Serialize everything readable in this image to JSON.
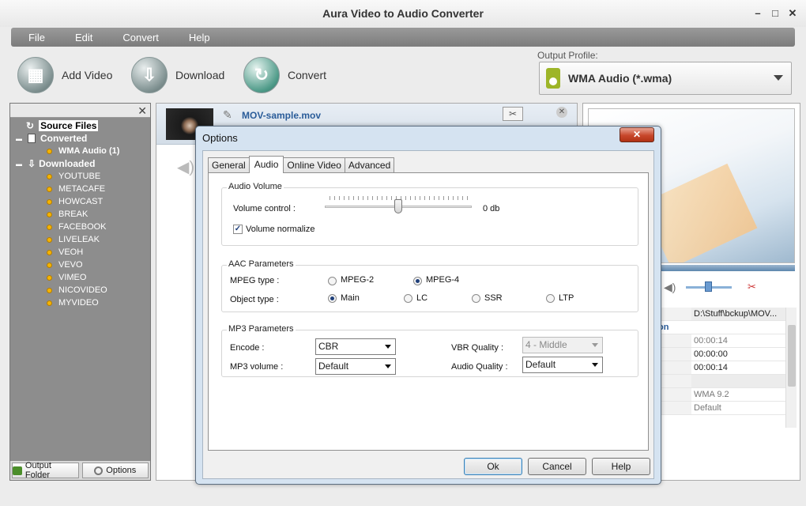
{
  "window": {
    "title": "Aura Video to Audio Converter"
  },
  "menu": [
    "File",
    "Edit",
    "Convert",
    "Help"
  ],
  "toolbar": {
    "add_video": "Add Video",
    "download": "Download",
    "convert": "Convert"
  },
  "output_profile": {
    "label": "Output Profile:",
    "value": "WMA Audio (*.wma)"
  },
  "tree": {
    "source_files": "Source Files",
    "converted": "Converted",
    "converted_items": [
      "WMA Audio (1)"
    ],
    "downloaded": "Downloaded",
    "downloaded_items": [
      "YOUTUBE",
      "METACAFE",
      "HOWCAST",
      "BREAK",
      "FACEBOOK",
      "LIVELEAK",
      "VEOH",
      "VEVO",
      "VIMEO",
      "NICOVIDEO",
      "MYVIDEO"
    ]
  },
  "left_footer": {
    "output_folder": "Output Folder",
    "options": "Options"
  },
  "file": {
    "name": "MOV-sample.mov"
  },
  "properties": {
    "path": "D:\\Stuff\\bckup\\MOV...",
    "category": "ion",
    "duration": "00:00:14",
    "start": "00:00:00",
    "end": "00:00:14",
    "codec": "WMA 9.2",
    "quality": "Default"
  },
  "dialog": {
    "title": "Options",
    "tabs": [
      "General",
      "Audio",
      "Online Video",
      "Advanced"
    ],
    "active_tab": "Audio",
    "audio_volume": {
      "title": "Audio Volume",
      "volume_label": "Volume control :",
      "volume_value": "0 db",
      "normalize_label": "Volume normalize"
    },
    "aac": {
      "title": "AAC Parameters",
      "mpeg_label": "MPEG type :",
      "mpeg_options": [
        "MPEG-2",
        "MPEG-4"
      ],
      "object_label": "Object type :",
      "object_options": [
        "Main",
        "LC",
        "SSR",
        "LTP"
      ]
    },
    "mp3": {
      "title": "MP3 Parameters",
      "encode_label": "Encode :",
      "encode_value": "CBR",
      "volume_label": "MP3 volume :",
      "volume_value": "Default",
      "vbr_label": "VBR Quality :",
      "vbr_value": "4 - Middle",
      "quality_label": "Audio Quality :",
      "quality_value": "Default"
    },
    "buttons": {
      "ok": "Ok",
      "cancel": "Cancel",
      "help": "Help"
    }
  }
}
